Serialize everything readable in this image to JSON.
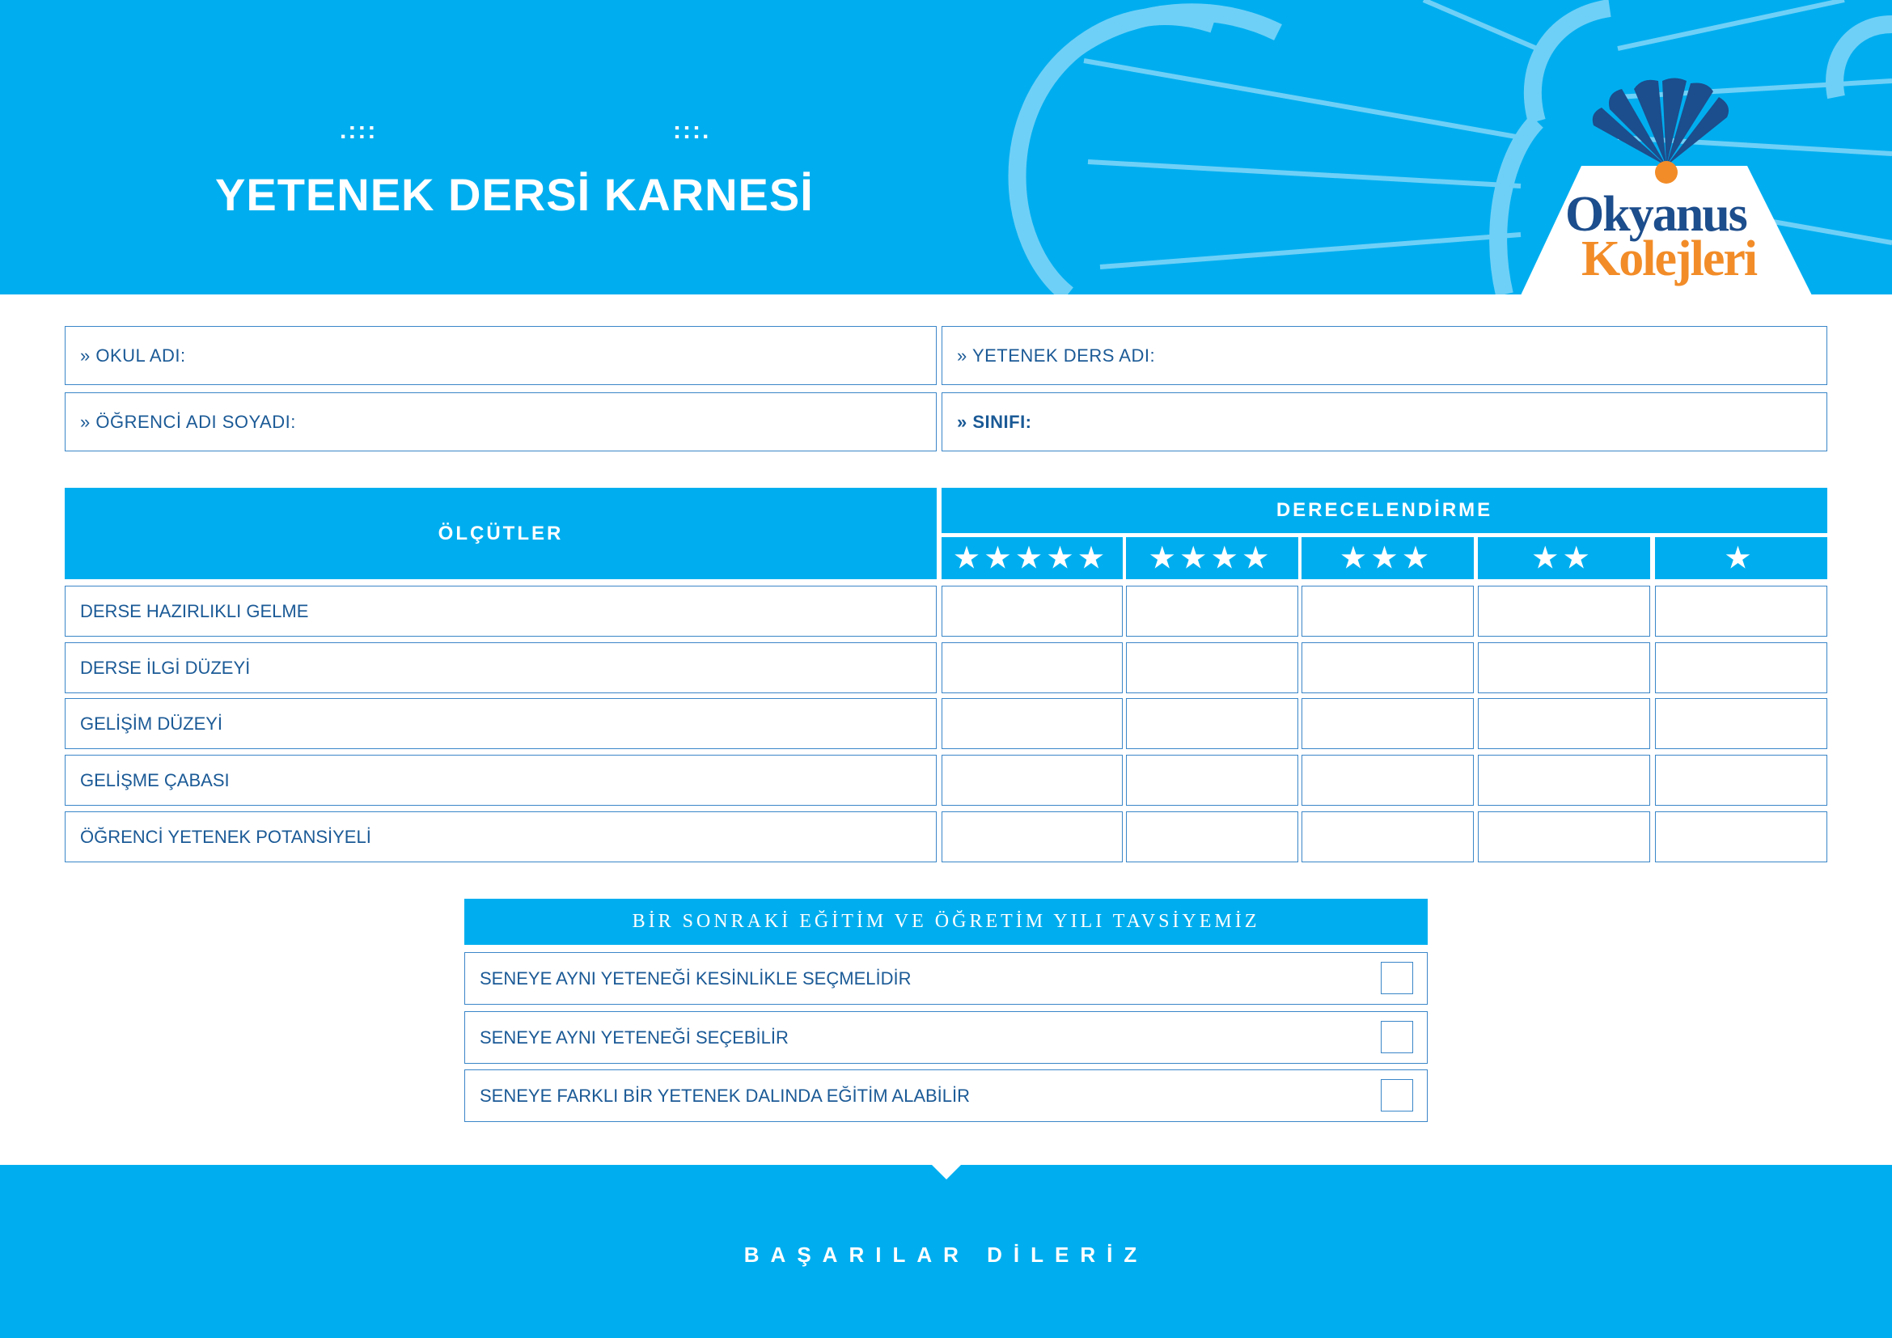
{
  "header": {
    "dots_left": ".:::",
    "dots_right": ":::.",
    "title": "YETENEK DERSİ KARNESİ",
    "logo_line1": "Okyanus",
    "logo_line2": "Kolejleri"
  },
  "info": {
    "school_label": "» OKUL ADI:",
    "talent_course_label": "» YETENEK DERS ADI:",
    "student_label": "» ÖĞRENCİ ADI SOYADI:",
    "class_label": "» SINIFI:"
  },
  "table": {
    "criteria_header": "ÖLÇÜTLER",
    "rating_header": "DERECELENDİRME",
    "rating_levels": [
      "★★★★★",
      "★★★★",
      "★★★",
      "★★",
      "★"
    ],
    "rows": [
      "DERSE HAZIRLIKLI GELME",
      "DERSE İLGİ DÜZEYİ",
      "GELİŞİM DÜZEYİ",
      "GELİŞME ÇABASI",
      "ÖĞRENCİ YETENEK POTANSİYELİ"
    ]
  },
  "recommendation": {
    "header": "BİR SONRAKİ EĞİTİM VE ÖĞRETİM YILI TAVSİYEMİZ",
    "options": [
      "SENEYE AYNI YETENEĞİ KESİNLİKLE SEÇMELİDİR",
      "SENEYE AYNI YETENEĞİ SEÇEBİLİR",
      "SENEYE FARKLI BİR YETENEK DALINDA EĞİTİM ALABİLİR"
    ]
  },
  "footer": {
    "text": "BAŞARILAR DİLERİZ"
  },
  "colors": {
    "primary_blue": "#00aeef",
    "text_blue": "#1b5a96",
    "border_blue": "#3a86c8",
    "logo_navy": "#1c4d8c",
    "logo_orange": "#f28c28"
  }
}
